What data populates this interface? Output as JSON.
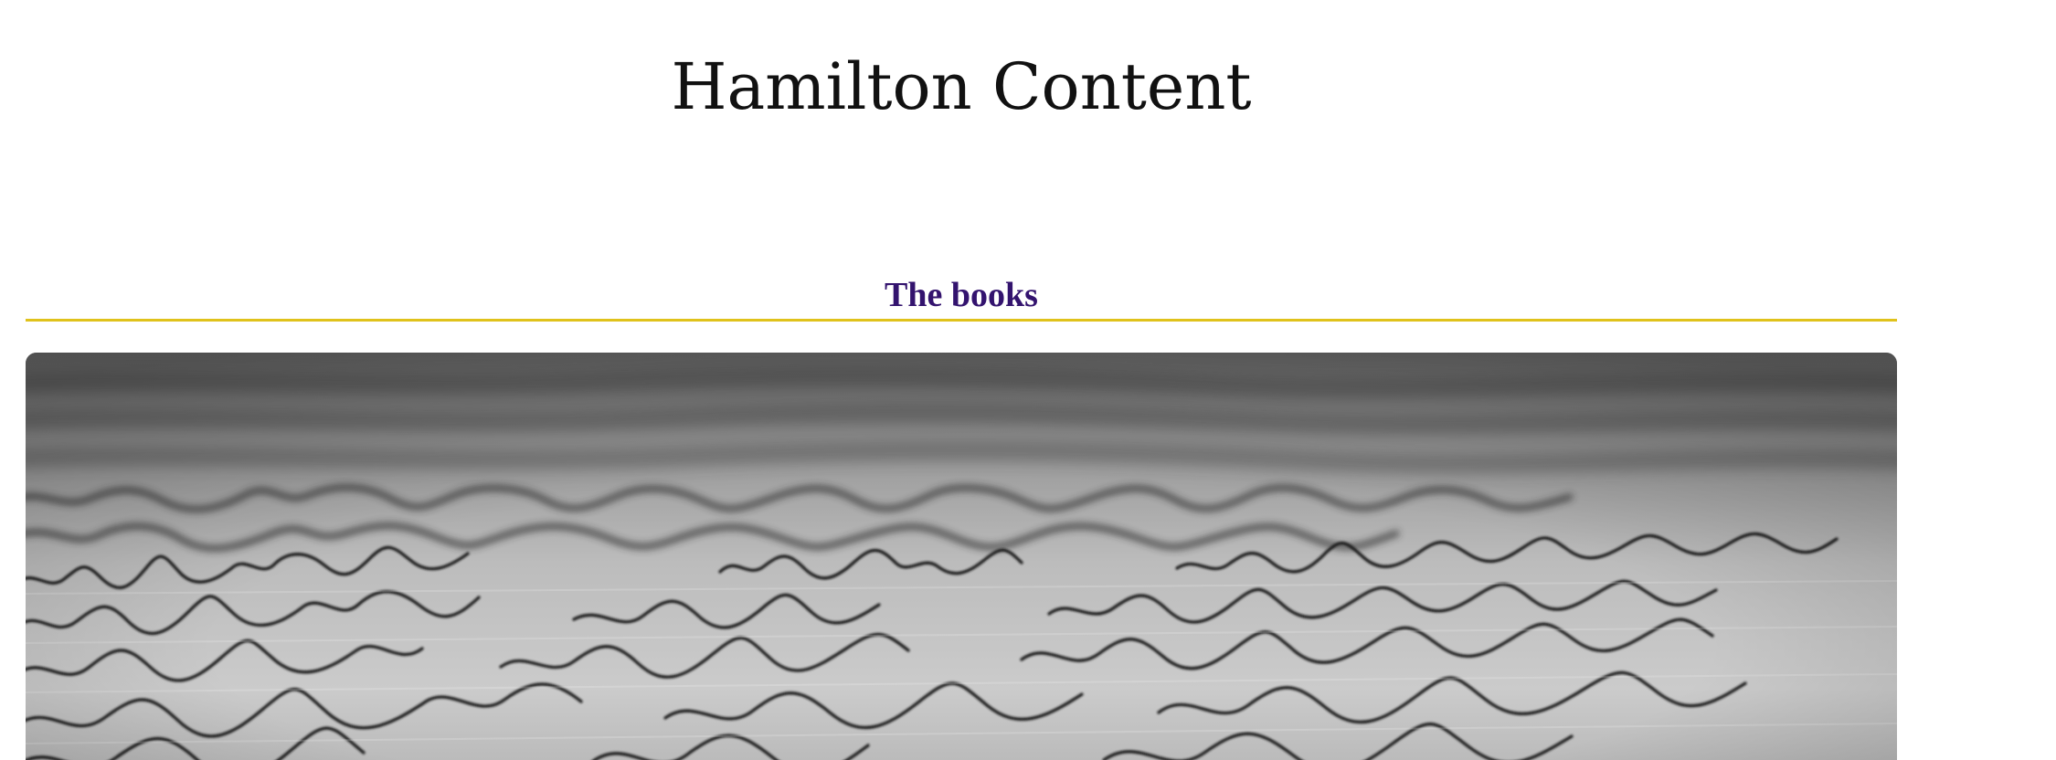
{
  "site": {
    "title": "Hamilton Content"
  },
  "section": {
    "heading": "The books"
  },
  "hero": {
    "subject": "handwritten-letter-photo"
  },
  "colors": {
    "heading": "#33136e",
    "divider": "#e0c21b",
    "title": "#111111"
  }
}
